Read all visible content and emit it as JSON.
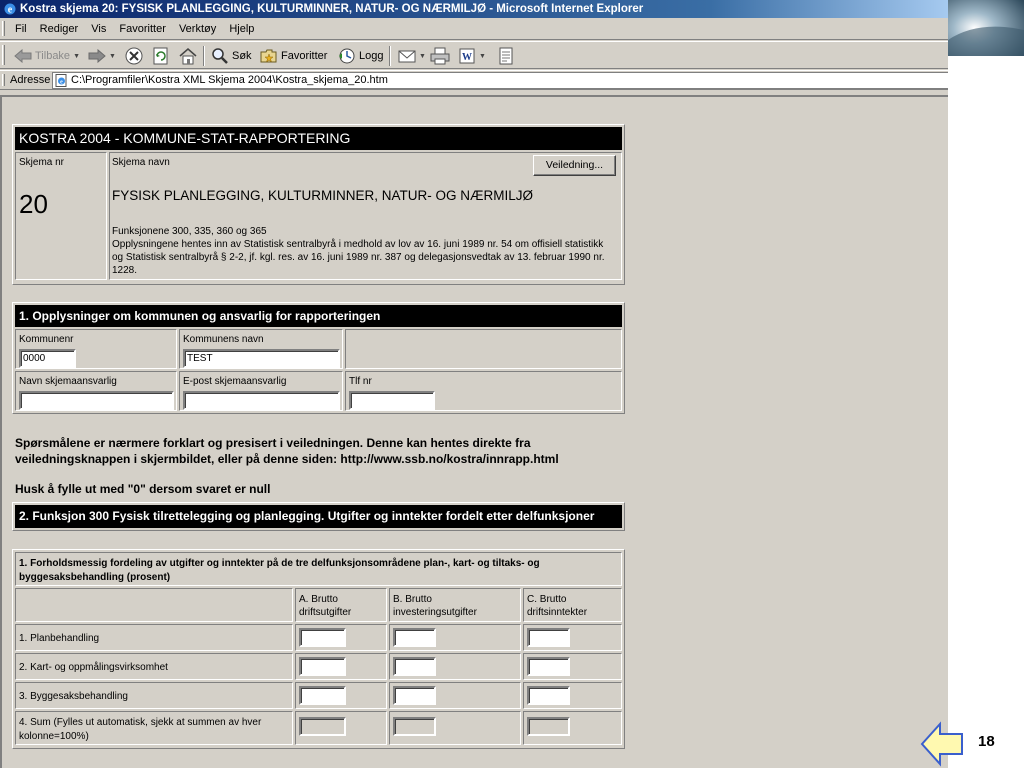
{
  "window": {
    "title": "Kostra skjema 20: FYSISK PLANLEGGING, KULTURMINNER, NATUR- OG NÆRMILJØ - Microsoft Internet Explorer"
  },
  "menubar": {
    "items": [
      "Fil",
      "Rediger",
      "Vis",
      "Favoritter",
      "Verktøy",
      "Hjelp"
    ]
  },
  "toolbar": {
    "back_label": "Tilbake",
    "search_label": "Søk",
    "favorites_label": "Favoritter",
    "history_label": "Logg"
  },
  "address": {
    "label": "Adresse",
    "value": "C:\\Programfiler\\Kostra XML Skjema 2004\\Kostra_skjema_20.htm"
  },
  "form": {
    "header": "KOSTRA 2004 - KOMMUNE-STAT-RAPPORTERING",
    "schema_nr_label": "Skjema nr",
    "schema_nr": "20",
    "schema_name_label": "Skjema navn",
    "guide_button": "Veiledning...",
    "schema_title": "FYSISK PLANLEGGING, KULTURMINNER, NATUR- OG NÆRMILJØ",
    "description_lines": [
      "Funksjonene 300, 335, 360 og 365",
      "Opplysningene hentes inn av Statistisk sentralbyrå i medhold av lov av 16. juni 1989 nr. 54 om offisiell statistikk",
      "og Statistisk sentralbyrå § 2-2, jf. kgl. res. av 16. juni 1989 nr. 387 og delegasjonsvedtak av 13. februar 1990 nr.",
      "1228."
    ],
    "section1": {
      "title": "1. Opplysninger om kommunen og ansvarlig for rapporteringen",
      "kommunenr_label": "Kommunenr",
      "kommunenr_value": "0000",
      "kommunenavn_label": "Kommunens navn",
      "kommunenavn_value": "TEST",
      "ansvarlig_label": "Navn skjemaansvarlig",
      "ansvarlig_value": "",
      "epost_label": "E-post skjemaansvarlig",
      "epost_value": "",
      "tlf_label": "Tlf nr",
      "tlf_value": ""
    },
    "info_line1": "Spørsmålene er nærmere forklart og presisert i veiledningen. Denne kan hentes direkte fra",
    "info_line2": "veiledningsknappen i skjermbildet, eller på denne siden: http://www.ssb.no/kostra/innrapp.html",
    "reminder": "Husk å fylle ut med \"0\" dersom svaret er null",
    "section2": {
      "title": "2. Funksjon 300 Fysisk tilrettelegging og planlegging. Utgifter og inntekter fordelt etter delfunksjoner"
    },
    "question1": {
      "title_line1": "1. Forholdsmessig fordeling av utgifter og inntekter på de tre delfunksjonsområdene plan-, kart- og tiltaks- og",
      "title_line2": "byggesaksbehandling (prosent)",
      "columns": [
        [
          "A. Brutto",
          "driftsutgifter"
        ],
        [
          "B. Brutto",
          "investeringsutgifter"
        ],
        [
          "C. Brutto",
          "driftsinntekter"
        ]
      ],
      "rows": [
        {
          "label": [
            "1. Planbehandling"
          ],
          "values": [
            "",
            "",
            ""
          ]
        },
        {
          "label": [
            "2. Kart- og oppmålingsvirksomhet"
          ],
          "values": [
            "",
            "",
            ""
          ]
        },
        {
          "label": [
            "3. Byggesaksbehandling"
          ],
          "values": [
            "",
            "",
            ""
          ]
        },
        {
          "label": [
            "4. Sum (Fylles ut automatisk, sjekk at summen av hver",
            "kolonne=100%)"
          ],
          "values": [
            "",
            "",
            ""
          ]
        }
      ]
    }
  },
  "slide": {
    "page_number": "18"
  }
}
